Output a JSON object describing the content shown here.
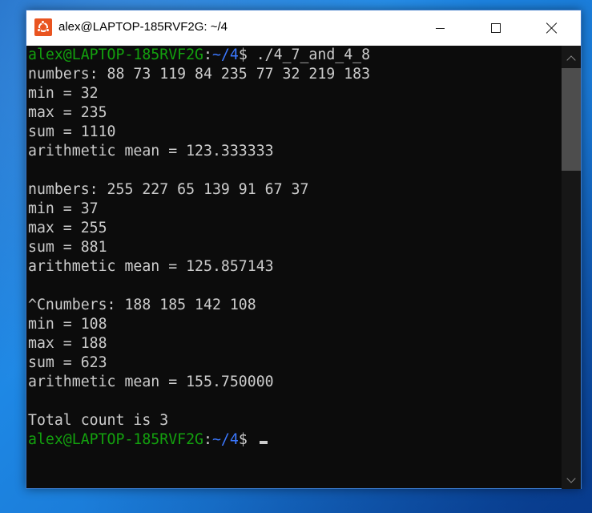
{
  "window": {
    "title": "alex@LAPTOP-185RVF2G: ~/4",
    "icon": "ubuntu-icon",
    "controls": [
      "minimize-icon",
      "maximize-icon",
      "close-icon"
    ]
  },
  "prompt": {
    "user": "alex@LAPTOP-185RVF2G",
    "colon": ":",
    "path": "~/4",
    "symbol": "$ "
  },
  "command": "./4_7_and_4_8",
  "output": [
    "numbers: 88 73 119 84 235 77 32 219 183",
    "min = 32",
    "max = 235",
    "sum = 1110",
    "arithmetic mean = 123.333333",
    "",
    "numbers: 255 227 65 139 91 67 37",
    "min = 37",
    "max = 255",
    "sum = 881",
    "arithmetic mean = 125.857143",
    "",
    "^Cnumbers: 188 185 142 108",
    "min = 108",
    "max = 188",
    "sum = 623",
    "arithmetic mean = 155.750000",
    "",
    "Total count is 3"
  ],
  "colors": {
    "background": "#0c0c0c",
    "text": "#cccccc",
    "user": "#13a10e",
    "path": "#3b78ff",
    "desktop": "#1976d2"
  }
}
